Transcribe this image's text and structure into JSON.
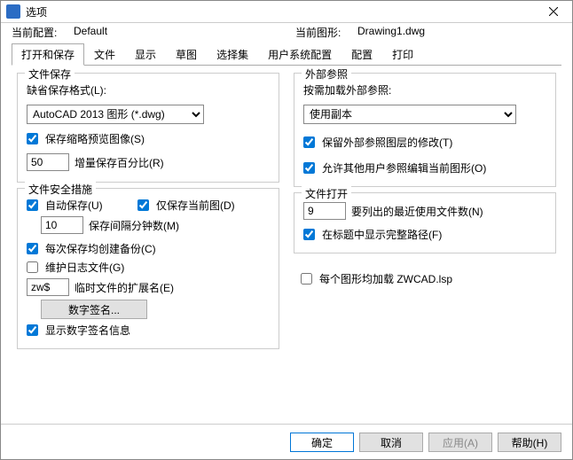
{
  "window": {
    "title": "选项"
  },
  "info": {
    "profile_label": "当前配置:",
    "profile_value": "Default",
    "drawing_label": "当前图形:",
    "drawing_value": "Drawing1.dwg"
  },
  "tabs": {
    "t0": "打开和保存",
    "t1": "文件",
    "t2": "显示",
    "t3": "草图",
    "t4": "选择集",
    "t5": "用户系统配置",
    "t6": "配置",
    "t7": "打印"
  },
  "left": {
    "file_save_title": "文件保存",
    "default_format_label": "缺省保存格式(L):",
    "default_format_value": "AutoCAD 2013 图形 (*.dwg)",
    "save_thumbnail": "保存缩略预览图像(S)",
    "inc_save_pct_value": "50",
    "inc_save_pct_label": "增量保存百分比(R)",
    "safety_title": "文件安全措施",
    "auto_save": "自动保存(U)",
    "save_current_only": "仅保存当前图(D)",
    "save_interval_value": "10",
    "save_interval_label": "保存间隔分钟数(M)",
    "backup_each_save": "每次保存均创建备份(C)",
    "maintain_log": "维护日志文件(G)",
    "temp_ext_value": "zw$",
    "temp_ext_label": "临时文件的扩展名(E)",
    "digital_sig_btn": "数字签名...",
    "show_digital_sig": "显示数字签名信息"
  },
  "right": {
    "xref_title": "外部参照",
    "xref_load_label": "按需加载外部参照:",
    "xref_load_value": "使用副本",
    "retain_layer_changes": "保留外部参照图层的修改(T)",
    "allow_others_refedit": "允许其他用户参照编辑当前图形(O)",
    "file_open_title": "文件打开",
    "recent_count_value": "9",
    "recent_count_label": "要列出的最近使用文件数(N)",
    "show_full_path": "在标题中显示完整路径(F)",
    "load_lsp_each": "每个图形均加载 ZWCAD.lsp"
  },
  "footer": {
    "ok": "确定",
    "cancel": "取消",
    "apply": "应用(A)",
    "help": "帮助(H)"
  }
}
